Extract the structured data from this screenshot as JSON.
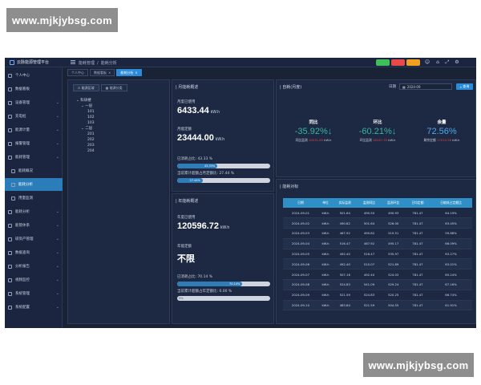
{
  "watermark": "www.mjkjybsg.com",
  "app": {
    "title": "云脉能源管理平台",
    "breadcrumb": [
      "能耗管理",
      "/",
      "能耗分析"
    ],
    "top_buttons": [
      {
        "label": "",
        "color": "#3fbf5a"
      },
      {
        "label": "",
        "color": "#e84a4a"
      },
      {
        "label": "",
        "color": "#f0a020"
      }
    ],
    "tabs": [
      {
        "label": "个人中心",
        "active": false
      },
      {
        "label": "数据看板",
        "active": false
      },
      {
        "label": "能耗分析",
        "active": true
      }
    ]
  },
  "sidebar": {
    "items": [
      {
        "label": "个人中心",
        "active": false,
        "sub": false,
        "chev": false
      },
      {
        "label": "数据看板",
        "active": false,
        "sub": false,
        "chev": false
      },
      {
        "label": "设备管理",
        "active": false,
        "sub": false,
        "chev": true
      },
      {
        "label": "充电桩",
        "active": false,
        "sub": false,
        "chev": true
      },
      {
        "label": "能源计量",
        "active": false,
        "sub": false,
        "chev": true
      },
      {
        "label": "报警管理",
        "active": false,
        "sub": false,
        "chev": true
      },
      {
        "label": "能耗管理",
        "active": false,
        "sub": false,
        "chev": true
      },
      {
        "label": "能耗概况",
        "active": false,
        "sub": true,
        "chev": false
      },
      {
        "label": "能耗分析",
        "active": true,
        "sub": true,
        "chev": false
      },
      {
        "label": "用量监测",
        "active": false,
        "sub": true,
        "chev": false
      },
      {
        "label": "能耗分析",
        "active": false,
        "sub": false,
        "chev": true
      },
      {
        "label": "能管体系",
        "active": false,
        "sub": false,
        "chev": true
      },
      {
        "label": "碳资产管理",
        "active": false,
        "sub": false,
        "chev": true
      },
      {
        "label": "数据查询",
        "active": false,
        "sub": false,
        "chev": true
      },
      {
        "label": "分析报告",
        "active": false,
        "sub": false,
        "chev": true
      },
      {
        "label": "视频监控",
        "active": false,
        "sub": false,
        "chev": true
      },
      {
        "label": "系统管理",
        "active": false,
        "sub": false,
        "chev": true
      },
      {
        "label": "系统配置",
        "active": false,
        "sub": false,
        "chev": true
      }
    ]
  },
  "tree_panel": {
    "tabs": [
      "能源区域",
      "能源分类"
    ],
    "nodes": [
      "⌄ 科研楼",
      "⌄ 一层",
      "101",
      "102",
      "103",
      "⌄ 二层",
      "201",
      "202",
      "203",
      "204"
    ]
  },
  "month_panel": {
    "title": "| 月能耗概述",
    "used_label": "月度已使用",
    "used_value": "6433.44",
    "used_unit": "kW.h",
    "quota_label": "月能定额",
    "quota_value": "23444.00",
    "quota_unit": "kW.h",
    "used_pct_label": "已消耗占比: 43.33 %",
    "used_pct": 43.33,
    "used_pct_text": "43.33%",
    "remain_pct_label": "当前累计超额占月定额比: 27.44 %",
    "remain_pct": 27.44,
    "remain_pct_text": "27.44%"
  },
  "year_panel": {
    "title": "| 年能耗概述",
    "used_label": "年度已使用",
    "used_value": "120596.72",
    "used_unit": "kW.h",
    "quota_label": "年能定额",
    "quota_value": "不限",
    "used_pct_label": "已消耗占比: 70.14 %",
    "used_pct": 70.14,
    "used_pct_text": "70.14%",
    "over_pct_label": "当前累计超额占年定额比: 0.00 %",
    "over_pct": 0,
    "over_pct_text": "0%"
  },
  "self_panel": {
    "title": "| 自耗(月度)",
    "date_label": "日期",
    "date_value": "2024-09",
    "query_label": "查询",
    "kpis": [
      {
        "title": "同比",
        "value": "-35.92%",
        "arrow": "↓",
        "color": "#35b6a0",
        "sub": "同比监测 ",
        "sub_red": "10031.85",
        "sub_unit": " kW.h"
      },
      {
        "title": "环比",
        "value": "-60.21%",
        "arrow": "↓",
        "color": "#35b6a0",
        "sub": "环比监测 ",
        "sub_red": "16167.35",
        "sub_unit": " kW.h"
      },
      {
        "title": "余量",
        "value": "72.56%",
        "arrow": "",
        "color": "#4aa8f0",
        "sub": "剩余定额 ",
        "sub_red": "17010.56",
        "sub_unit": " kW.h"
      }
    ]
  },
  "compare_panel": {
    "title": "| 能耗对标",
    "columns": [
      "日期",
      "单位",
      "实际监测",
      "监测同比",
      "监测环比",
      "日均定额",
      "日能耗占定额比"
    ],
    "rows": [
      [
        "2024-09-01",
        "kW.h",
        "501.64",
        "490.50",
        "490.93",
        "781.47",
        "64.19%"
      ],
      [
        "2024-09-02",
        "kW.h",
        "490.82",
        "501.64",
        "526.00",
        "781.47",
        "63.45%"
      ],
      [
        "2024-09-03",
        "kW.h",
        "467.92",
        "490.82",
        "519.51",
        "781.47",
        "59.88%"
      ],
      [
        "2024-09-04",
        "kW.h",
        "516.47",
        "467.92",
        "495.17",
        "781.47",
        "66.09%"
      ],
      [
        "2024-09-05",
        "kW.h",
        "492.40",
        "516.47",
        "535.97",
        "781.47",
        "63.27%"
      ],
      [
        "2024-09-06",
        "kW.h",
        "492.40",
        "510.07",
        "521.89",
        "781.47",
        "63.01%"
      ],
      [
        "2024-09-07",
        "kW.h",
        "507.16",
        "492.40",
        "524.03",
        "781.47",
        "65.24%"
      ],
      [
        "2024-09-08",
        "kW.h",
        "524.83",
        "541.09",
        "529.24",
        "781.47",
        "67.16%"
      ],
      [
        "2024-09-09",
        "kW.h",
        "521.59",
        "524.83",
        "520.25",
        "781.47",
        "66.74%"
      ],
      [
        "2024-09-10",
        "kW.h",
        "483.84",
        "521.59",
        "504.55",
        "781.47",
        "61.91%"
      ]
    ]
  }
}
